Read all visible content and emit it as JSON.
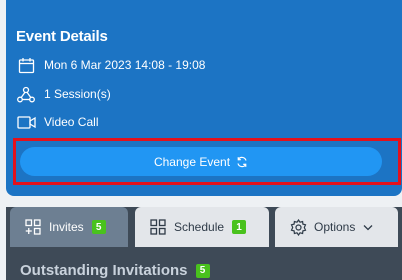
{
  "event": {
    "title": "Event Details",
    "datetime": "Mon 6 Mar 2023 14:08 - 19:08",
    "sessions": "1 Session(s)",
    "type": "Video Call",
    "change_label": "Change Event"
  },
  "tabs": [
    {
      "label": "Invites",
      "badge": "5",
      "icon": "grid-plus-icon",
      "active": true
    },
    {
      "label": "Schedule",
      "badge": "1",
      "icon": "grid-icon",
      "active": false
    },
    {
      "label": "Options",
      "icon": "gear-icon",
      "active": false
    }
  ],
  "section": {
    "title": "Outstanding Invitations",
    "badge": "5"
  },
  "colors": {
    "card_bg": "#1c74c4",
    "button_bg": "#2196f3",
    "highlight": "#e3111b",
    "badge_green": "#49c21d",
    "active_tab": "#6d7f92"
  }
}
